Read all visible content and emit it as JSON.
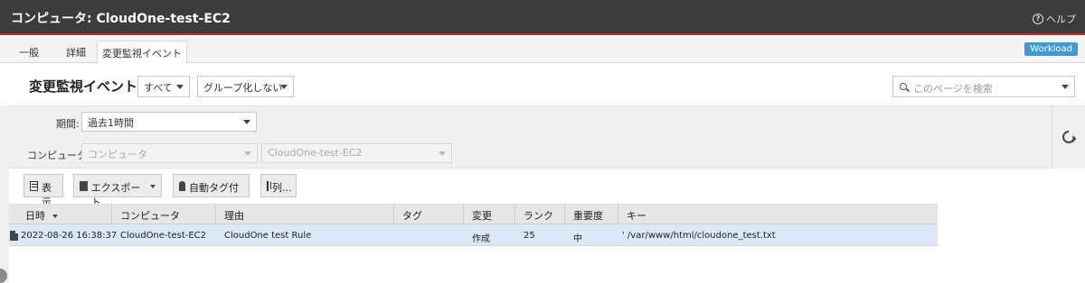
{
  "window": {
    "title": "コンピュータ: CloudOne-test-EC2",
    "help_label": "ヘルプ"
  },
  "tabs": [
    {
      "label": "一般"
    },
    {
      "label": "詳細"
    },
    {
      "label": "変更監視イベント"
    }
  ],
  "badge": {
    "label": "Workload",
    "color": "#3d9ad6"
  },
  "header": {
    "title": "変更監視イベント",
    "filter_all": "すべて",
    "group_by": "グループ化しない",
    "search_placeholder": "このページを検索"
  },
  "filters": {
    "period_label": "期間:",
    "period_value": "過去1時間",
    "computer_label": "コンピュータ:",
    "computer_scope": "コンピュータ",
    "computer_value": "CloudOne-test-EC2"
  },
  "toolbar": {
    "show_label": "表示",
    "export_label": "エクスポート",
    "autotag_label": "自動タグ付け...",
    "columns_label": "列..."
  },
  "table": {
    "columns": [
      "日時",
      "コンピュータ",
      "理由",
      "タグ",
      "変更",
      "ランク",
      "重要度",
      "キー"
    ],
    "rows": [
      {
        "datetime": "2022-08-26 16:38:37",
        "computer": "CloudOne-test-EC2",
        "reason": "CloudOne test Rule",
        "tag": "",
        "change": "作成",
        "rank": "25",
        "severity": "中",
        "key": "' /var/www/html/cloudone_test.txt"
      }
    ]
  }
}
